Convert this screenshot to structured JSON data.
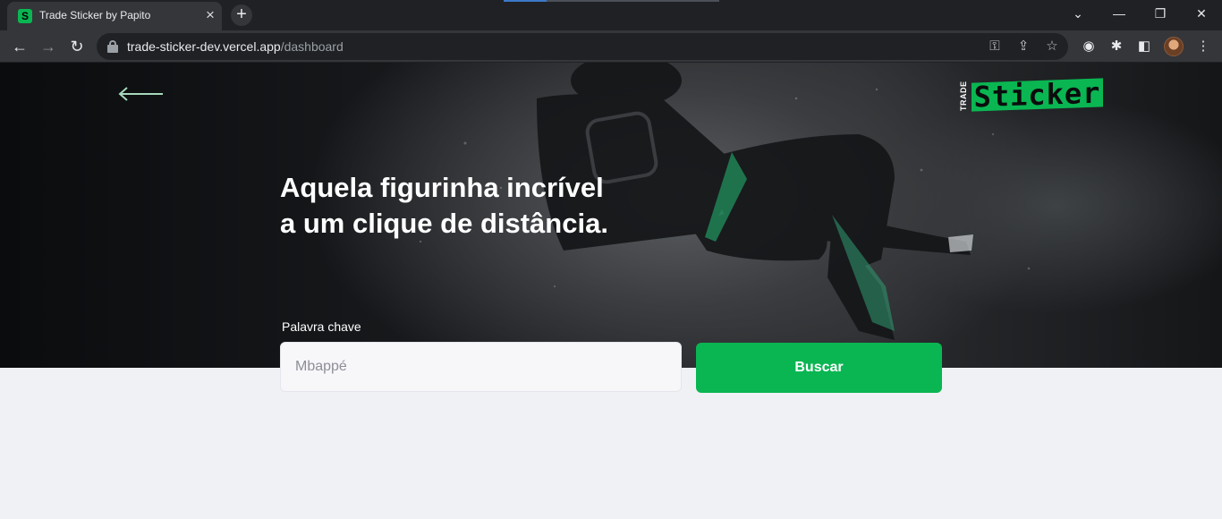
{
  "browser": {
    "tab_title": "Trade Sticker by Papito",
    "tab_favicon_glyph": "S",
    "url_host": "trade-sticker-dev.vercel.app",
    "url_path": "/dashboard"
  },
  "page": {
    "logo": {
      "small_text": "TRADE",
      "main_text": "Sticker"
    },
    "headline": "Aquela figurinha incrível a um clique de distância.",
    "search": {
      "label": "Palavra chave",
      "placeholder": "Mbappé",
      "button_label": "Buscar"
    }
  },
  "colors": {
    "brand_green": "#0ab652",
    "page_background": "#f0f1f5",
    "hero_dark": "#1b1d20"
  }
}
